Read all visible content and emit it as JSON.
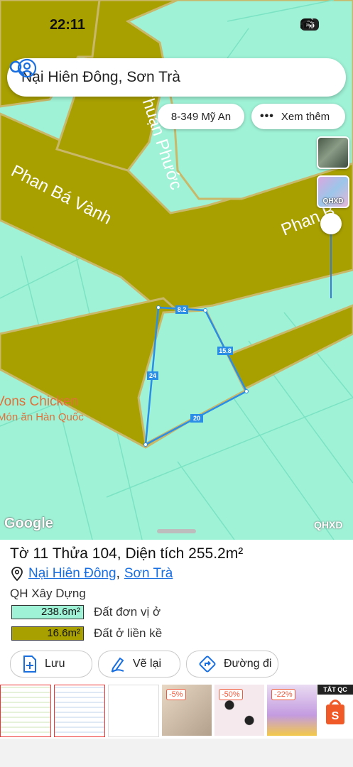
{
  "status": {
    "time": "22:11",
    "battery": "46"
  },
  "search": {
    "title": "Nại Hiên Đông, Sơn Trà"
  },
  "chips": {
    "address": "8-349 Mỹ An",
    "more": "Xem thêm"
  },
  "map": {
    "streets": [
      "Phan Bá Vành",
      "Thuận Phước",
      "Phan B"
    ],
    "poi": [
      "Vons Chicken",
      "Món ăn Hàn Quốc"
    ],
    "edges": [
      "8.2",
      "15.8",
      "24",
      "20"
    ],
    "layer_thumb_label": "QHXD",
    "google_label": "Google",
    "corner_label": "QHXD"
  },
  "parcel": {
    "title": "Tờ 11 Thửa 104, Diện tích 255.2m²",
    "ward": "Nại Hiên Đông",
    "district": "Sơn Trà",
    "separator": ",",
    "plan_type": "QH Xây Dựng",
    "zones": [
      {
        "area": "238.6m²",
        "label": "Đất đơn vị ở",
        "color": "#9ff2d6"
      },
      {
        "area": "16.6m²",
        "label": "Đất ở liền kề",
        "color": "#a8a000"
      }
    ]
  },
  "actions": {
    "save": "Lưu",
    "redraw": "Vẽ lại",
    "directions": "Đường đi"
  },
  "ads": {
    "discounts": [
      "-5%",
      "-50%",
      "-22%"
    ],
    "close_label": "TẮT QC"
  },
  "colors": {
    "accent": "#1a6fe0",
    "land_green": "#9ff2d6",
    "road_olive": "#a8a000"
  }
}
